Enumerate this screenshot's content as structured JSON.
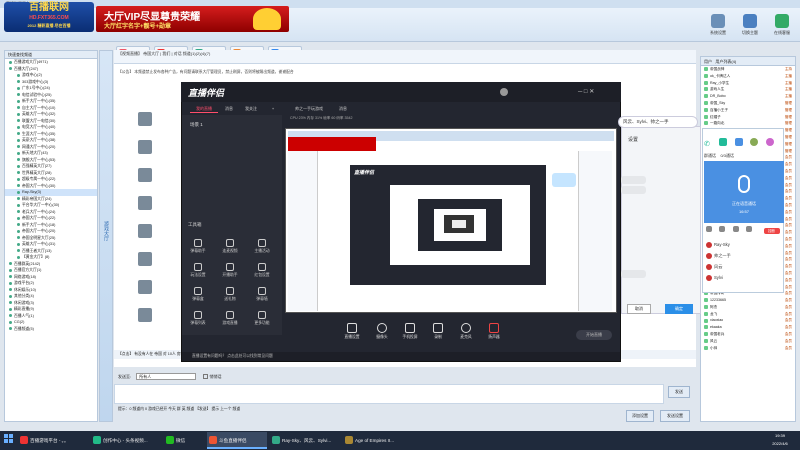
{
  "outer": {
    "title": "直播联网平台-HD.FXT365.COM",
    "logo": {
      "line1": "百播联网",
      "line2": "HD.FXT365.COM",
      "line3": "2012 精彩直播 尽在百播"
    },
    "vip": {
      "line1": "大厅VIP尽显尊贵荣耀",
      "line2": "大厅红字名字+靓号+勋章"
    },
    "toolbar": [
      "平台主页",
      "官方微博",
      "帮助说明",
      "使用教程",
      "帮助教程"
    ],
    "right_tools": [
      "系统设置",
      "切换主题",
      "在线客服"
    ],
    "left_head": "快速查找频道",
    "left_tab": "游戏大厅",
    "tree": [
      "百播游戏大厅(4971)",
      "百播大厅(247)",
      "游戏中心(2)",
      "303游戏中心(3)",
      "广东1号中心(24)",
      "电信试验中心(25)",
      "新手大厅一中心(35)",
      "自主大厅一中心(10)",
      "英雄大厅一中心(32)",
      "联盟大厅一电信(30)",
      "电竞大厅一中心(40)",
      "生涯大厅一中心(35)",
      "英豪大厅一中心(38)",
      "网通大厅一中心(20)",
      "新天地大厅(43)",
      "旗舰大厅一中心(53)",
      "百强精英大厅(27)",
      "世界精英大厅(28)",
      "超级专属一中心(22)",
      "帝国大厅一中心(30)",
      "Ray-Sky(3)",
      "精彩帝国大厅(24)",
      "平台华大厅一中心(30)",
      "老兵大厅一中心(24)",
      "帝国大厅一中心(22)",
      "新手大厅一中心(18)",
      "帝国大厅一中心(20)",
      "帝国全明星大厅(25)",
      "英雄大厅一中心(31)",
      "百播王者大厅(13)",
      "【黄金大厅】(8)",
      "百播群英(2142)",
      "百播官方大厅(1)",
      "网络游戏(18)",
      "游戏平台(2)",
      "休闲娱乐(10)",
      "其他分类(4)",
      "休闲游戏(3)",
      "精彩直播(9)",
      "百播人气(1)",
      "CG(2)",
      "百播频道(5)"
    ],
    "chat_head": "【视频直播】 帝国大厅 | 我们 | 对话 频道(1)(2)(4)(7)",
    "chat_notice": "【公告】 本频道禁止发布各种广告，有问题请联系大厅管理员，禁止刷屏，否则将被踢出频道，谢谢配合",
    "bottom_line": "【点击】 有没有人在 帝国 对 10人 房间",
    "input_label": "发送至:",
    "input_select": "所有人",
    "input_check": "悄悄话",
    "send": "发送",
    "status_line": "提示：0 频道内  0 游戏已经开   今天 群 英 频道  【发送】 提示 上一个  频道",
    "bottom_buttons": [
      "添加设置",
      "发送设置"
    ],
    "right_tabs": [
      "用户",
      "用户列表(4)"
    ],
    "users": [
      {
        "name": "帝国战神",
        "role": "主持"
      },
      {
        "name": "ok_卡牌达人",
        "role": "主播"
      },
      {
        "name": "Ray_小学生",
        "role": "主播"
      },
      {
        "name": "游戏人生",
        "role": "主播"
      },
      {
        "name": "DR_Bobo",
        "role": "主播"
      },
      {
        "name": "帝国_Sky",
        "role": "管理"
      },
      {
        "name": "百播小王子",
        "role": "管理"
      },
      {
        "name": "红帽子",
        "role": "管理"
      },
      {
        "name": "一路向北",
        "role": "管理"
      },
      {
        "name": "帝国_神",
        "role": "管理"
      },
      {
        "name": "Ray_Sky",
        "role": "管理"
      },
      {
        "name": "大眼",
        "role": "管理"
      },
      {
        "name": "鬼王",
        "role": "管理"
      },
      {
        "name": "小飞侠",
        "role": "会员"
      },
      {
        "name": "帝国新手",
        "role": "会员"
      },
      {
        "name": "游戏一哥",
        "role": "会员"
      },
      {
        "name": "小小兵",
        "role": "会员"
      },
      {
        "name": "老鹰",
        "role": "会员"
      },
      {
        "name": "冰雪",
        "role": "会员"
      },
      {
        "name": "疾风",
        "role": "会员"
      },
      {
        "name": "帝国霸王",
        "role": "会员"
      },
      {
        "name": "追风",
        "role": "会员"
      },
      {
        "name": "骑士",
        "role": "会员"
      },
      {
        "name": "寻梦",
        "role": "会员"
      },
      {
        "name": "雷神",
        "role": "会员"
      },
      {
        "name": "大海",
        "role": "会员"
      },
      {
        "name": "13233458888",
        "role": "会员"
      },
      {
        "name": "帝国之光",
        "role": "会员"
      },
      {
        "name": "帝国之星",
        "role": "会员"
      },
      {
        "name": "星辰",
        "role": "会员"
      },
      {
        "name": "小黑",
        "role": "会员"
      },
      {
        "name": "小白",
        "role": "会员"
      },
      {
        "name": "百播新人",
        "role": "会员"
      },
      {
        "name": "帝国传奇",
        "role": "会员"
      },
      {
        "name": "12233665",
        "role": "会员"
      },
      {
        "name": "阿杰",
        "role": "会员"
      },
      {
        "name": "龙飞",
        "role": "会员"
      },
      {
        "name": "xiaoxiao",
        "role": "会员"
      },
      {
        "name": "ekaaka",
        "role": "会员"
      },
      {
        "name": "帝国老兵",
        "role": "会员"
      },
      {
        "name": "风云",
        "role": "会员"
      },
      {
        "name": "小帅",
        "role": "会员"
      }
    ]
  },
  "live": {
    "logo": "直播伴侣",
    "tabs": [
      "我的直播",
      "消息",
      "我关注",
      "+",
      "帅之一手玩游戏",
      "消息"
    ],
    "scene": "场景 1",
    "toolbox_label": "工具箱",
    "tools": [
      "弹幕助手",
      "连麦视频",
      "主播活动",
      "玩法设置",
      "开播助手",
      "红包设置",
      "弹幕盒",
      "送礼物",
      "弹幕墙",
      "弹幕列表",
      "游戏直播",
      "更多功能"
    ],
    "bottom": [
      "直播设置",
      "摄像头",
      "手机投屏",
      "录制",
      "麦克风",
      "扬声器"
    ],
    "start": "开始直播",
    "status": "直播设置有问题吗？ 点击此处可以找到常见问题",
    "preview_top": "直播伴侣直播",
    "stats": "CPU 23%  内存 31%  帧率 60  码率 3542"
  },
  "float": {
    "title_pill": "风云、Sylvi、帅之一手",
    "settings": "设置",
    "btn_cancel": "取消",
    "btn_ok": "确定"
  },
  "voice": {
    "tabs": [
      "群通话",
      "0/3通话"
    ],
    "status": "正在语音通话",
    "timer": "16:57",
    "users": [
      {
        "name": "Ray-Sky"
      },
      {
        "name": "帅之一手"
      },
      {
        "name": "风云"
      },
      {
        "name": "Sylvi"
      }
    ],
    "end_label": "挂断"
  },
  "taskbar": {
    "items": [
      {
        "label": "百播游戏平台 - 。。",
        "color": "#e33"
      },
      {
        "label": "创作中心 - 头条视频...",
        "color": "#2b8"
      },
      {
        "label": "微信",
        "color": "#2b2"
      },
      {
        "label": "斗鱼直播伴侣",
        "color": "#e53",
        "active": true
      },
      {
        "label": "Ray-Sky、风云、Sylvi...",
        "color": "#3a8"
      },
      {
        "label": "Age of Empires II...",
        "color": "#a83"
      }
    ],
    "time": "19:39",
    "date": "2022/4/6"
  }
}
